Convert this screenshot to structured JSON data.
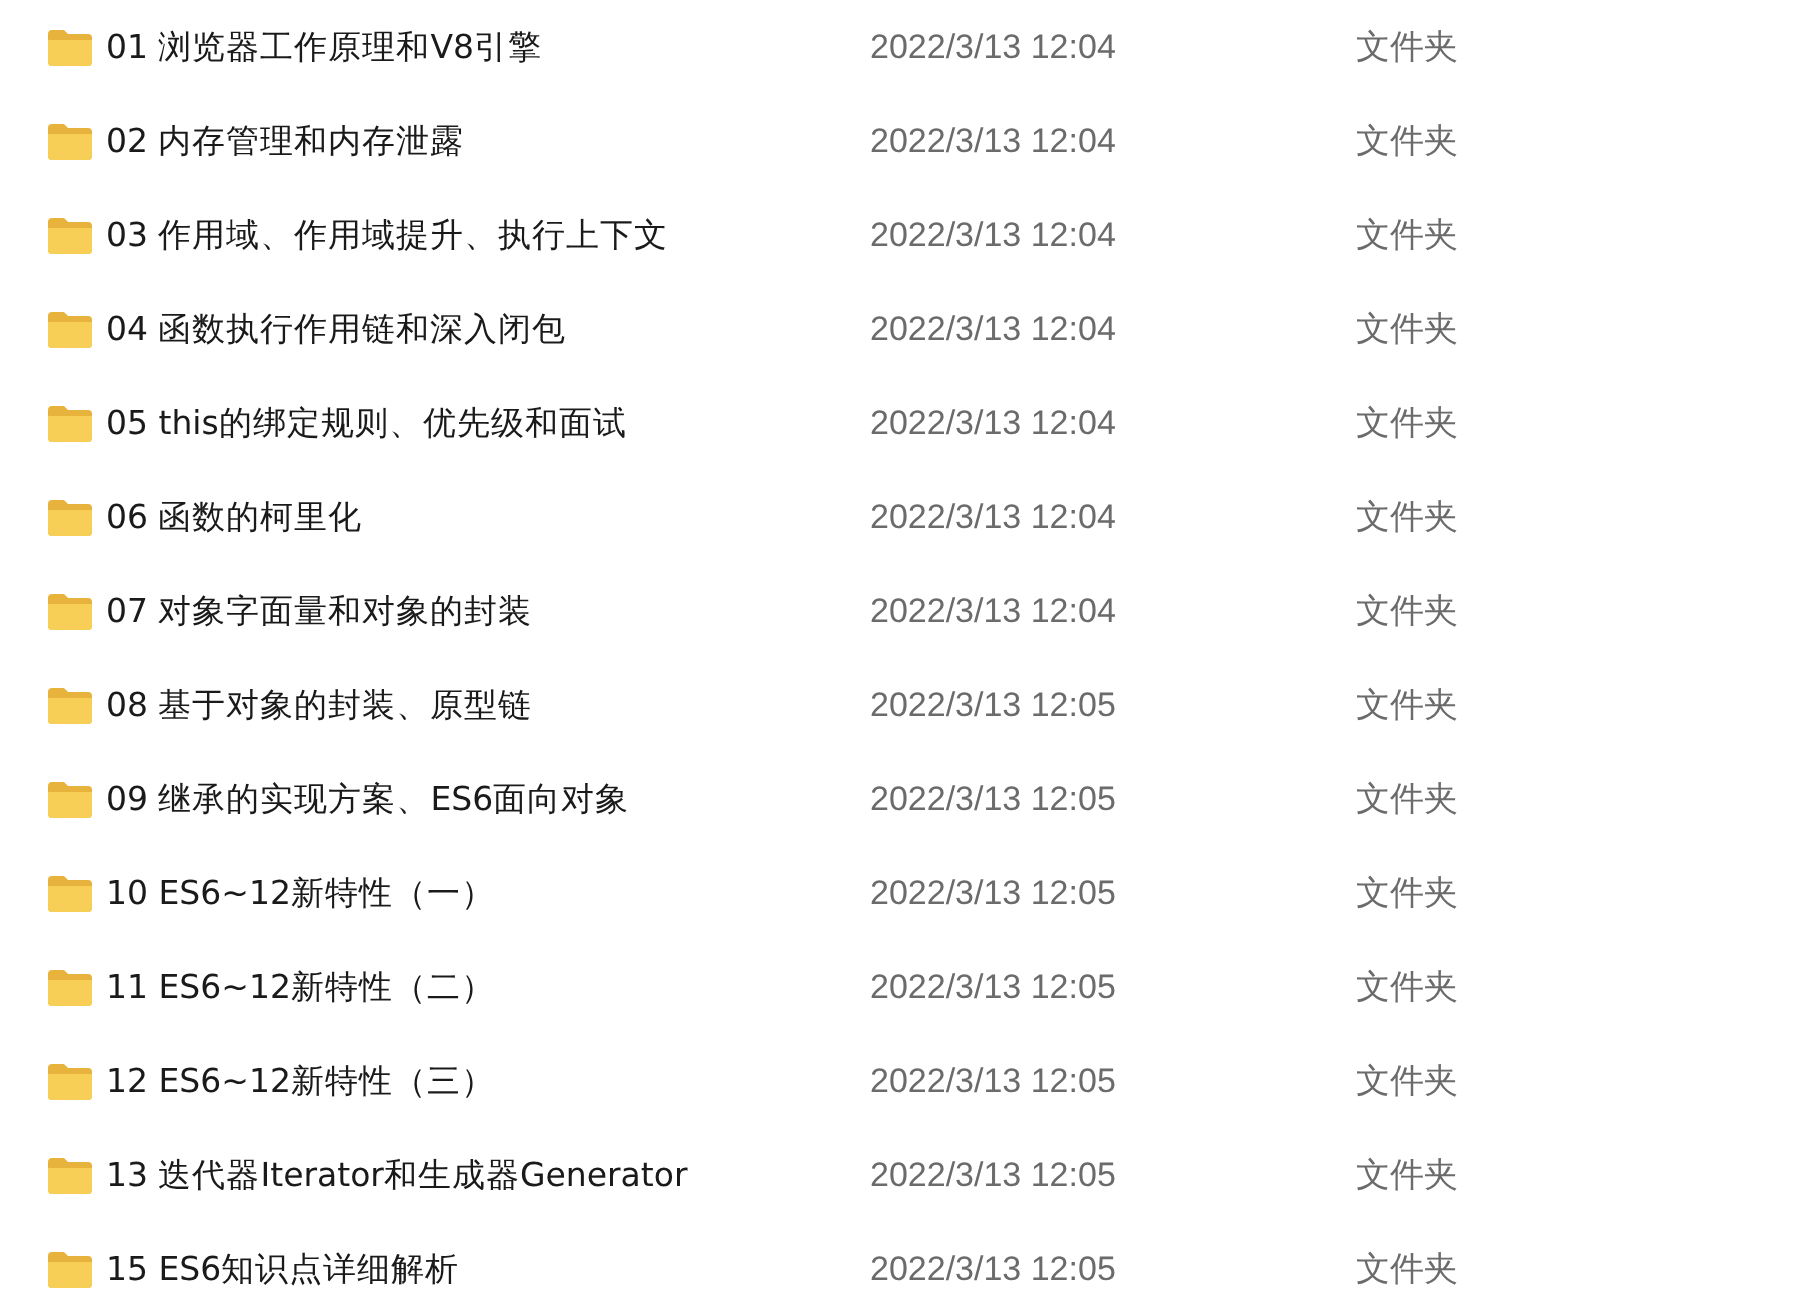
{
  "files": [
    {
      "name": "01 浏览器工作原理和V8引擎",
      "modified": "2022/3/13 12:04",
      "type": "文件夹"
    },
    {
      "name": "02 内存管理和内存泄露",
      "modified": "2022/3/13 12:04",
      "type": "文件夹"
    },
    {
      "name": "03 作用域、作用域提升、执行上下文",
      "modified": "2022/3/13 12:04",
      "type": "文件夹"
    },
    {
      "name": "04 函数执行作用链和深入闭包",
      "modified": "2022/3/13 12:04",
      "type": "文件夹"
    },
    {
      "name": "05 this的绑定规则、优先级和面试",
      "modified": "2022/3/13 12:04",
      "type": "文件夹"
    },
    {
      "name": "06 函数的柯里化",
      "modified": "2022/3/13 12:04",
      "type": "文件夹"
    },
    {
      "name": "07 对象字面量和对象的封装",
      "modified": "2022/3/13 12:04",
      "type": "文件夹"
    },
    {
      "name": "08 基于对象的封装、原型链",
      "modified": "2022/3/13 12:05",
      "type": "文件夹"
    },
    {
      "name": "09 继承的实现方案、ES6面向对象",
      "modified": "2022/3/13 12:05",
      "type": "文件夹"
    },
    {
      "name": "10 ES6~12新特性（一）",
      "modified": "2022/3/13 12:05",
      "type": "文件夹"
    },
    {
      "name": "11 ES6~12新特性（二）",
      "modified": "2022/3/13 12:05",
      "type": "文件夹"
    },
    {
      "name": "12 ES6~12新特性（三）",
      "modified": "2022/3/13 12:05",
      "type": "文件夹"
    },
    {
      "name": "13 迭代器Iterator和生成器Generator",
      "modified": "2022/3/13 12:05",
      "type": "文件夹"
    },
    {
      "name": "15 ES6知识点详细解析",
      "modified": "2022/3/13 12:05",
      "type": "文件夹"
    }
  ]
}
